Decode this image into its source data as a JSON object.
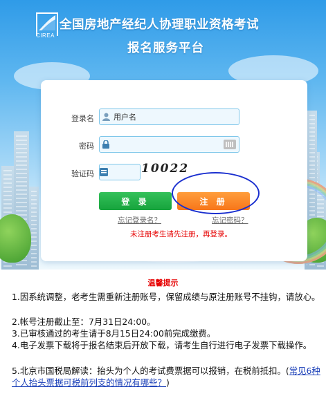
{
  "header": {
    "logo_text": "CIREA",
    "title_line1": "全国房地产经纪人协理职业资格考试",
    "title_line2": "报名服务平台"
  },
  "login": {
    "username_label": "登录名",
    "username_placeholder": "用户名",
    "password_label": "密码",
    "captcha_label": "验证码",
    "captcha_text": "10022",
    "login_button": "登 录",
    "register_button": "注 册",
    "forgot_username": "忘记登录名？",
    "forgot_password": "忘记密码？",
    "register_notice": "未注册考生请先注册，再登录。"
  },
  "tips": {
    "title": "温馨提示",
    "items": [
      "1.因系统调整，老考生需重新注册账号，保留成绩与原注册账号不挂钩，请放心。",
      "2.帐号注册截止至：7月31日24:00。",
      "3.已审核通过的考生请于8月15日24:00前完成缴费。",
      "4.电子发票下载将于报名结束后开放下载，请考生自行进行电子发票下载操作。",
      "5.北京市国税局解读：抬头为个人的考试费票据可以报销，在税前抵扣。("
    ],
    "link_text": "常见6种个人抬头票据可税前列支的情况有哪些？",
    "link_suffix": ")"
  },
  "colors": {
    "login_button": "#1eab43",
    "register_button": "#f7821f",
    "notice": "#e60000",
    "annotation_circle": "#1a2fcf"
  }
}
